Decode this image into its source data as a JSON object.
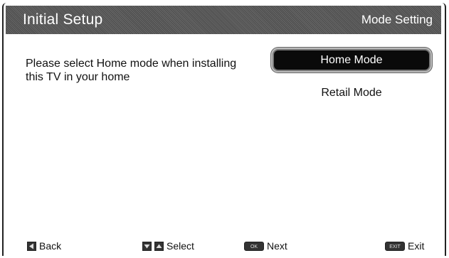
{
  "header": {
    "title": "Initial Setup",
    "section": "Mode Setting"
  },
  "description": "Please select Home mode when installing this TV in your home",
  "options": [
    {
      "label": "Home Mode",
      "selected": true
    },
    {
      "label": "Retail Mode",
      "selected": false
    }
  ],
  "footer": {
    "back": "Back",
    "select": "Select",
    "next": "Next",
    "exit": "Exit",
    "ok_key": "OK",
    "exit_key": "EXIT"
  }
}
